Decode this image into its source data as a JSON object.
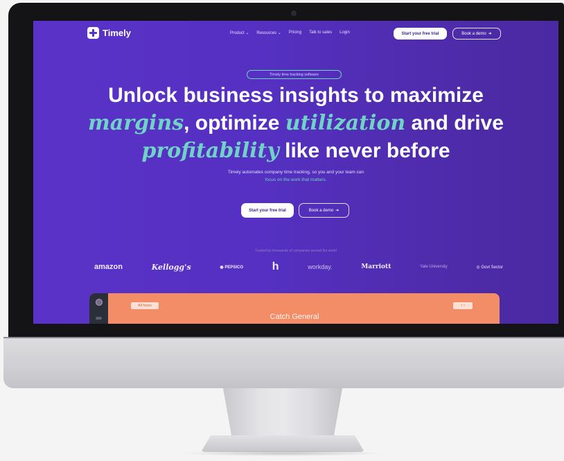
{
  "brand": {
    "name": "Timely",
    "purple": "#5a32c8",
    "teal": "#6fd3c6",
    "orange": "#f28d67"
  },
  "nav": {
    "links": [
      "Product ⌄",
      "Resources ⌄",
      "Pricing",
      "Talk to sales",
      "Login"
    ],
    "trial_label": "Start your free trial",
    "demo_label": "Book a demo"
  },
  "hero": {
    "pill": "Timely time tracking software",
    "line1": "Unlock business insights to maximize",
    "w_margins": "margins",
    "t_optimize": ", optimize ",
    "w_utilization": "utilization",
    "t_and_drive": " and drive",
    "w_profitability": "profitability",
    "t_tail": " like never before",
    "sub_line": "Timely automates company time tracking, so you and your team can",
    "sub_accent": "focus on the work that matters.",
    "trial_label": "Start your free trial",
    "demo_label": "Book a demo"
  },
  "trusted": {
    "caption": "Trusted by thousands of companies around the world",
    "logos": [
      "amazon",
      "Kellogg's",
      "PEPSICO",
      "h",
      "workday.",
      "Marriott",
      "Yale University",
      "Govt Sector"
    ]
  },
  "preview": {
    "tag": "All hours",
    "controls": "‹ ›",
    "title": "Catch General"
  }
}
